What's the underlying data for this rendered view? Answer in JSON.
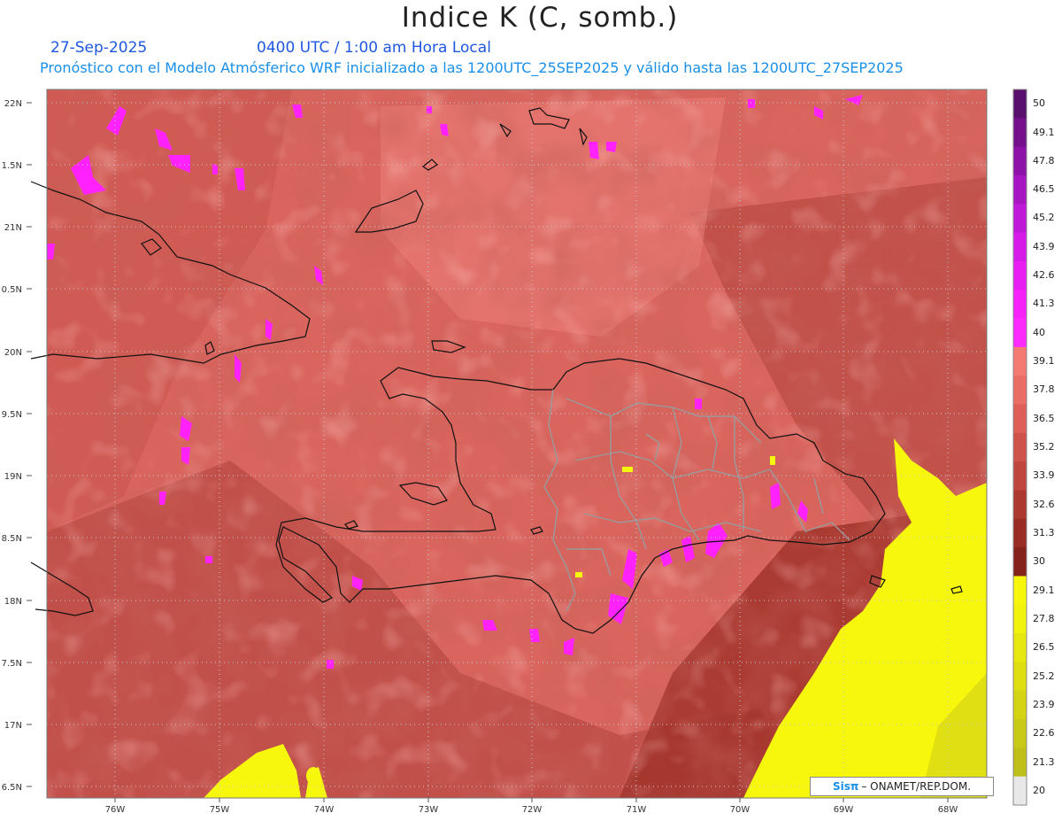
{
  "header": {
    "title": "Indice K (C, somb.)",
    "date": "27-Sep-2025",
    "time": "0400 UTC / 1:00 am Hora Local",
    "forecast": "Pronóstico con el Modelo Atmósferico WRF inicializado a las 1200UTC_25SEP2025 y válido hasta las  1200UTC_27SEP2025"
  },
  "axes": {
    "lat_labels": [
      "22N",
      "1.5N",
      "21N",
      "0.5N",
      "20N",
      "9.5N",
      "19N",
      "8.5N",
      "18N",
      "7.5N",
      "17N",
      "6.5N"
    ],
    "lon_labels": [
      "76W",
      "75W",
      "74W",
      "73W",
      "72W",
      "71W",
      "70W",
      "69W",
      "68W"
    ]
  },
  "colorbar": {
    "labels": [
      "50",
      "49.1",
      "47.8",
      "46.5",
      "45.2",
      "43.9",
      "42.6",
      "41.3",
      "40",
      "39.1",
      "37.8",
      "36.5",
      "35.2",
      "33.9",
      "32.6",
      "31.3",
      "30",
      "29.1",
      "27.8",
      "26.5",
      "25.2",
      "23.9",
      "22.6",
      "21.3",
      "20"
    ],
    "colors": [
      "#5a0f6e",
      "#750f8c",
      "#8f12a8",
      "#a815c3",
      "#c018d8",
      "#d61be8",
      "#e81ef2",
      "#f522fa",
      "#ff2aff",
      "#f57a73",
      "#ea6d66",
      "#dd5f58",
      "#cf524b",
      "#bf453e",
      "#ad3832",
      "#992c25",
      "#85221b",
      "#f7f70d",
      "#f2f20f",
      "#e8e811",
      "#dede13",
      "#d4d415",
      "#c9c917",
      "#bfbf19",
      "#e8e8e8"
    ]
  },
  "credit": {
    "logo": "Sisπ",
    "text": "– ONAMET/REP.DOM."
  }
}
